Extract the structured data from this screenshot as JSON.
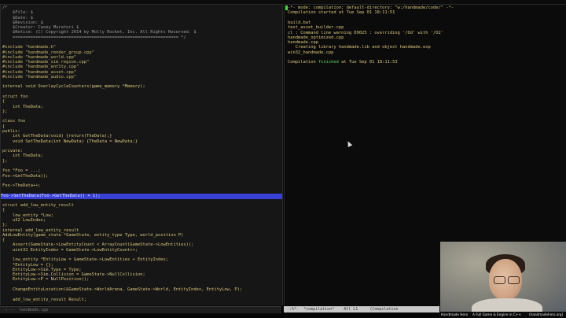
{
  "left_editor": {
    "lines": [
      {
        "text": "/*",
        "kind": "comment"
      },
      {
        "text": "    $File: $",
        "kind": "comment"
      },
      {
        "text": "    $Date: $",
        "kind": "comment"
      },
      {
        "text": "    $Revision: $",
        "kind": "comment"
      },
      {
        "text": "    $Creator: Casey Muratori $",
        "kind": "comment"
      },
      {
        "text": "    $Notice: (C) Copyright 2014 by Molly Rocket, Inc. All Rights Reserved. $",
        "kind": "comment"
      },
      {
        "text": "    ================================================================= */",
        "kind": "comment"
      },
      {
        "text": "",
        "kind": "code"
      },
      {
        "text": "#include \"handmade.h\"",
        "kind": "preproc"
      },
      {
        "text": "#include \"handmade_render_group.cpp\"",
        "kind": "preproc"
      },
      {
        "text": "#include \"handmade_world.cpp\"",
        "kind": "preproc"
      },
      {
        "text": "#include \"handmade_sim_region.cpp\"",
        "kind": "preproc"
      },
      {
        "text": "#include \"handmade_entity.cpp\"",
        "kind": "preproc"
      },
      {
        "text": "#include \"handmade_asset.cpp\"",
        "kind": "preproc"
      },
      {
        "text": "#include \"handmade_audio.cpp\"",
        "kind": "preproc"
      },
      {
        "text": "",
        "kind": "code"
      },
      {
        "text": "internal void OverlayCycleCounters(game_memory *Memory);",
        "kind": "code"
      },
      {
        "text": "",
        "kind": "code"
      },
      {
        "text": "struct foo",
        "kind": "code"
      },
      {
        "text": "{",
        "kind": "code"
      },
      {
        "text": "    int TheData;",
        "kind": "code"
      },
      {
        "text": "};",
        "kind": "code"
      },
      {
        "text": "",
        "kind": "code"
      },
      {
        "text": "class foo",
        "kind": "code"
      },
      {
        "text": "{",
        "kind": "code"
      },
      {
        "text": "public:",
        "kind": "code"
      },
      {
        "text": "    int GetTheData(void) {return(TheData);}",
        "kind": "code"
      },
      {
        "text": "    void SetTheData(int NewData) {TheData = NewData;}",
        "kind": "code"
      },
      {
        "text": "",
        "kind": "code"
      },
      {
        "text": "private:",
        "kind": "code"
      },
      {
        "text": "    int TheData;",
        "kind": "code"
      },
      {
        "text": "};",
        "kind": "code"
      },
      {
        "text": "",
        "kind": "code"
      },
      {
        "text": "foo *Foo = ...;",
        "kind": "code"
      },
      {
        "text": "Foo->GetTheData();",
        "kind": "code"
      },
      {
        "text": "",
        "kind": "code"
      },
      {
        "text": "Foo->TheData++;",
        "kind": "code"
      },
      {
        "text": "",
        "kind": "code"
      },
      {
        "text": "Foo->SetTheData(Foo->GetTheData() + 1);",
        "kind": "highlight"
      },
      {
        "text": "",
        "kind": "code"
      },
      {
        "text": "struct add_low_entity_result",
        "kind": "code"
      },
      {
        "text": "{",
        "kind": "code"
      },
      {
        "text": "    low_entity *Low;",
        "kind": "code"
      },
      {
        "text": "    u32 LowIndex;",
        "kind": "code"
      },
      {
        "text": "};",
        "kind": "code"
      },
      {
        "text": "internal add_low_entity_result",
        "kind": "code"
      },
      {
        "text": "AddLowEntity(game_state *GameState, entity_type Type, world_position P)",
        "kind": "code"
      },
      {
        "text": "{",
        "kind": "code"
      },
      {
        "text": "    Assert(GameState->LowEntityCount < ArrayCount(GameState->LowEntities));",
        "kind": "code"
      },
      {
        "text": "    uint32 EntityIndex = GameState->LowEntityCount++;",
        "kind": "code"
      },
      {
        "text": "",
        "kind": "code"
      },
      {
        "text": "    low_entity *EntityLow = GameState->LowEntities + EntityIndex;",
        "kind": "code"
      },
      {
        "text": "    *EntityLow = {};",
        "kind": "code"
      },
      {
        "text": "    EntityLow->Sim.Type = Type;",
        "kind": "code"
      },
      {
        "text": "    EntityLow->Sim.Collision = GameState->NullCollision;",
        "kind": "code"
      },
      {
        "text": "    EntityLow->P = NullPosition();",
        "kind": "code"
      },
      {
        "text": "",
        "kind": "code"
      },
      {
        "text": "    ChangeEntityLocation(&GameState->WorldArena, GameState->World, EntityIndex, EntityLow, P);",
        "kind": "code"
      },
      {
        "text": "",
        "kind": "code"
      },
      {
        "text": "    add_low_entity_result Result;",
        "kind": "code"
      }
    ]
  },
  "right_compilation": {
    "lines": [
      {
        "pre": "-*- mode: compilation; default-directory: \"w:/handmade/code/\" -*-",
        "ok": "",
        "post": ""
      },
      {
        "pre": "Compilation started at Tue Sep 01 18:11:51",
        "ok": "",
        "post": ""
      },
      {
        "pre": "",
        "ok": "",
        "post": ""
      },
      {
        "pre": "build.bat",
        "ok": "",
        "post": ""
      },
      {
        "pre": "test_asset_builder.cpp",
        "ok": "",
        "post": ""
      },
      {
        "pre": "cl : Command line warning D9025 : overriding '/Od' with '/O2'",
        "ok": "",
        "post": ""
      },
      {
        "pre": "handmade_optimized.cpp",
        "ok": "",
        "post": ""
      },
      {
        "pre": "handmade.cpp",
        "ok": "",
        "post": ""
      },
      {
        "pre": "   Creating library handmade.lib and object handmade.exp",
        "ok": "",
        "post": ""
      },
      {
        "pre": "win32_handmade.cpp",
        "ok": "",
        "post": ""
      },
      {
        "pre": "",
        "ok": "",
        "post": ""
      },
      {
        "pre": "Compilation ",
        "ok": "finished",
        "post": " at Tue Sep 01 18:11:53"
      }
    ]
  },
  "modelines": {
    "left": "-:---  handmade.cpp",
    "right": "-:%*-  *compilation*    All L1     (Compilation"
  },
  "taskbar": {
    "items": [
      "Handmade Hero",
      "A Full Game & Engine in C++",
      "(handmadehero.org)"
    ]
  },
  "colors": {
    "highlight": "#3a40d6",
    "finished": "#5cd35c",
    "text": "#d6c37a"
  }
}
